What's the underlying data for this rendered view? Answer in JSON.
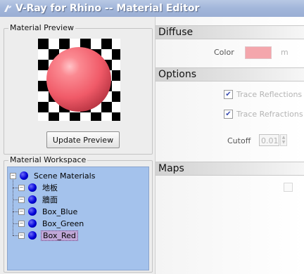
{
  "window": {
    "title": "V-Ray for Rhino -- Material Editor",
    "icon": "vray-icon"
  },
  "preview": {
    "legend": "Material Preview",
    "update_button": "Update Preview",
    "sphere_color": "#f06070"
  },
  "workspace": {
    "legend": "Material Workspace",
    "root": "Scene Materials",
    "items": [
      {
        "label": "地板"
      },
      {
        "label": "牆面"
      },
      {
        "label": "Box_Blue"
      },
      {
        "label": "Box_Green"
      },
      {
        "label": "Box_Red",
        "selected": true
      }
    ]
  },
  "diffuse": {
    "header": "Diffuse",
    "color_label": "Color",
    "color_value": "#f4a6ac",
    "map_button": "m"
  },
  "options": {
    "header": "Options",
    "trace_reflections": "Trace Reflections",
    "trace_refractions": "Trace Refractions",
    "cutoff_label": "Cutoff",
    "cutoff_value": "0.01"
  },
  "maps": {
    "header": "Maps"
  }
}
